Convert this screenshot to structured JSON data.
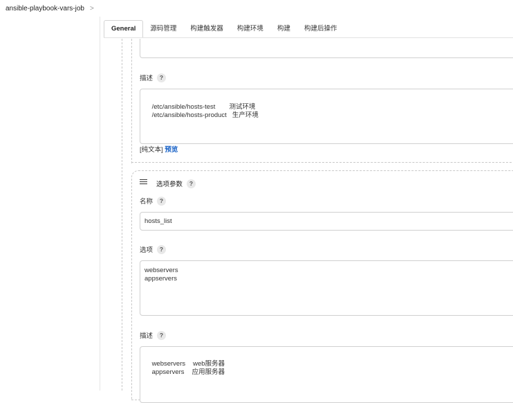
{
  "breadcrumb": {
    "job": "ansible-playbook-vars-job",
    "separator": ">"
  },
  "tabs": [
    {
      "label": "General",
      "active": true
    },
    {
      "label": "源码管理"
    },
    {
      "label": "构建触发器"
    },
    {
      "label": "构建环境"
    },
    {
      "label": "构建"
    },
    {
      "label": "构建后操作"
    }
  ],
  "param1": {
    "description_label": "描述",
    "description_lines": [
      {
        "path": "/etc/ansible/hosts-test",
        "note": "测试环境"
      },
      {
        "path": "/etc/ansible/hosts-product",
        "note": "生产环境"
      }
    ],
    "plain_text": "[纯文本]",
    "preview": "预览"
  },
  "param2": {
    "title": "选项参数",
    "name_label": "名称",
    "name_value": "hosts_list",
    "choices_label": "选项",
    "choices": [
      "webservers",
      "appservers"
    ],
    "description_label": "描述",
    "description_lines": [
      {
        "key": "webservers",
        "note": "web服务器"
      },
      {
        "key": "appservers",
        "note": "应用服务器"
      }
    ]
  },
  "help_glyph": "?"
}
